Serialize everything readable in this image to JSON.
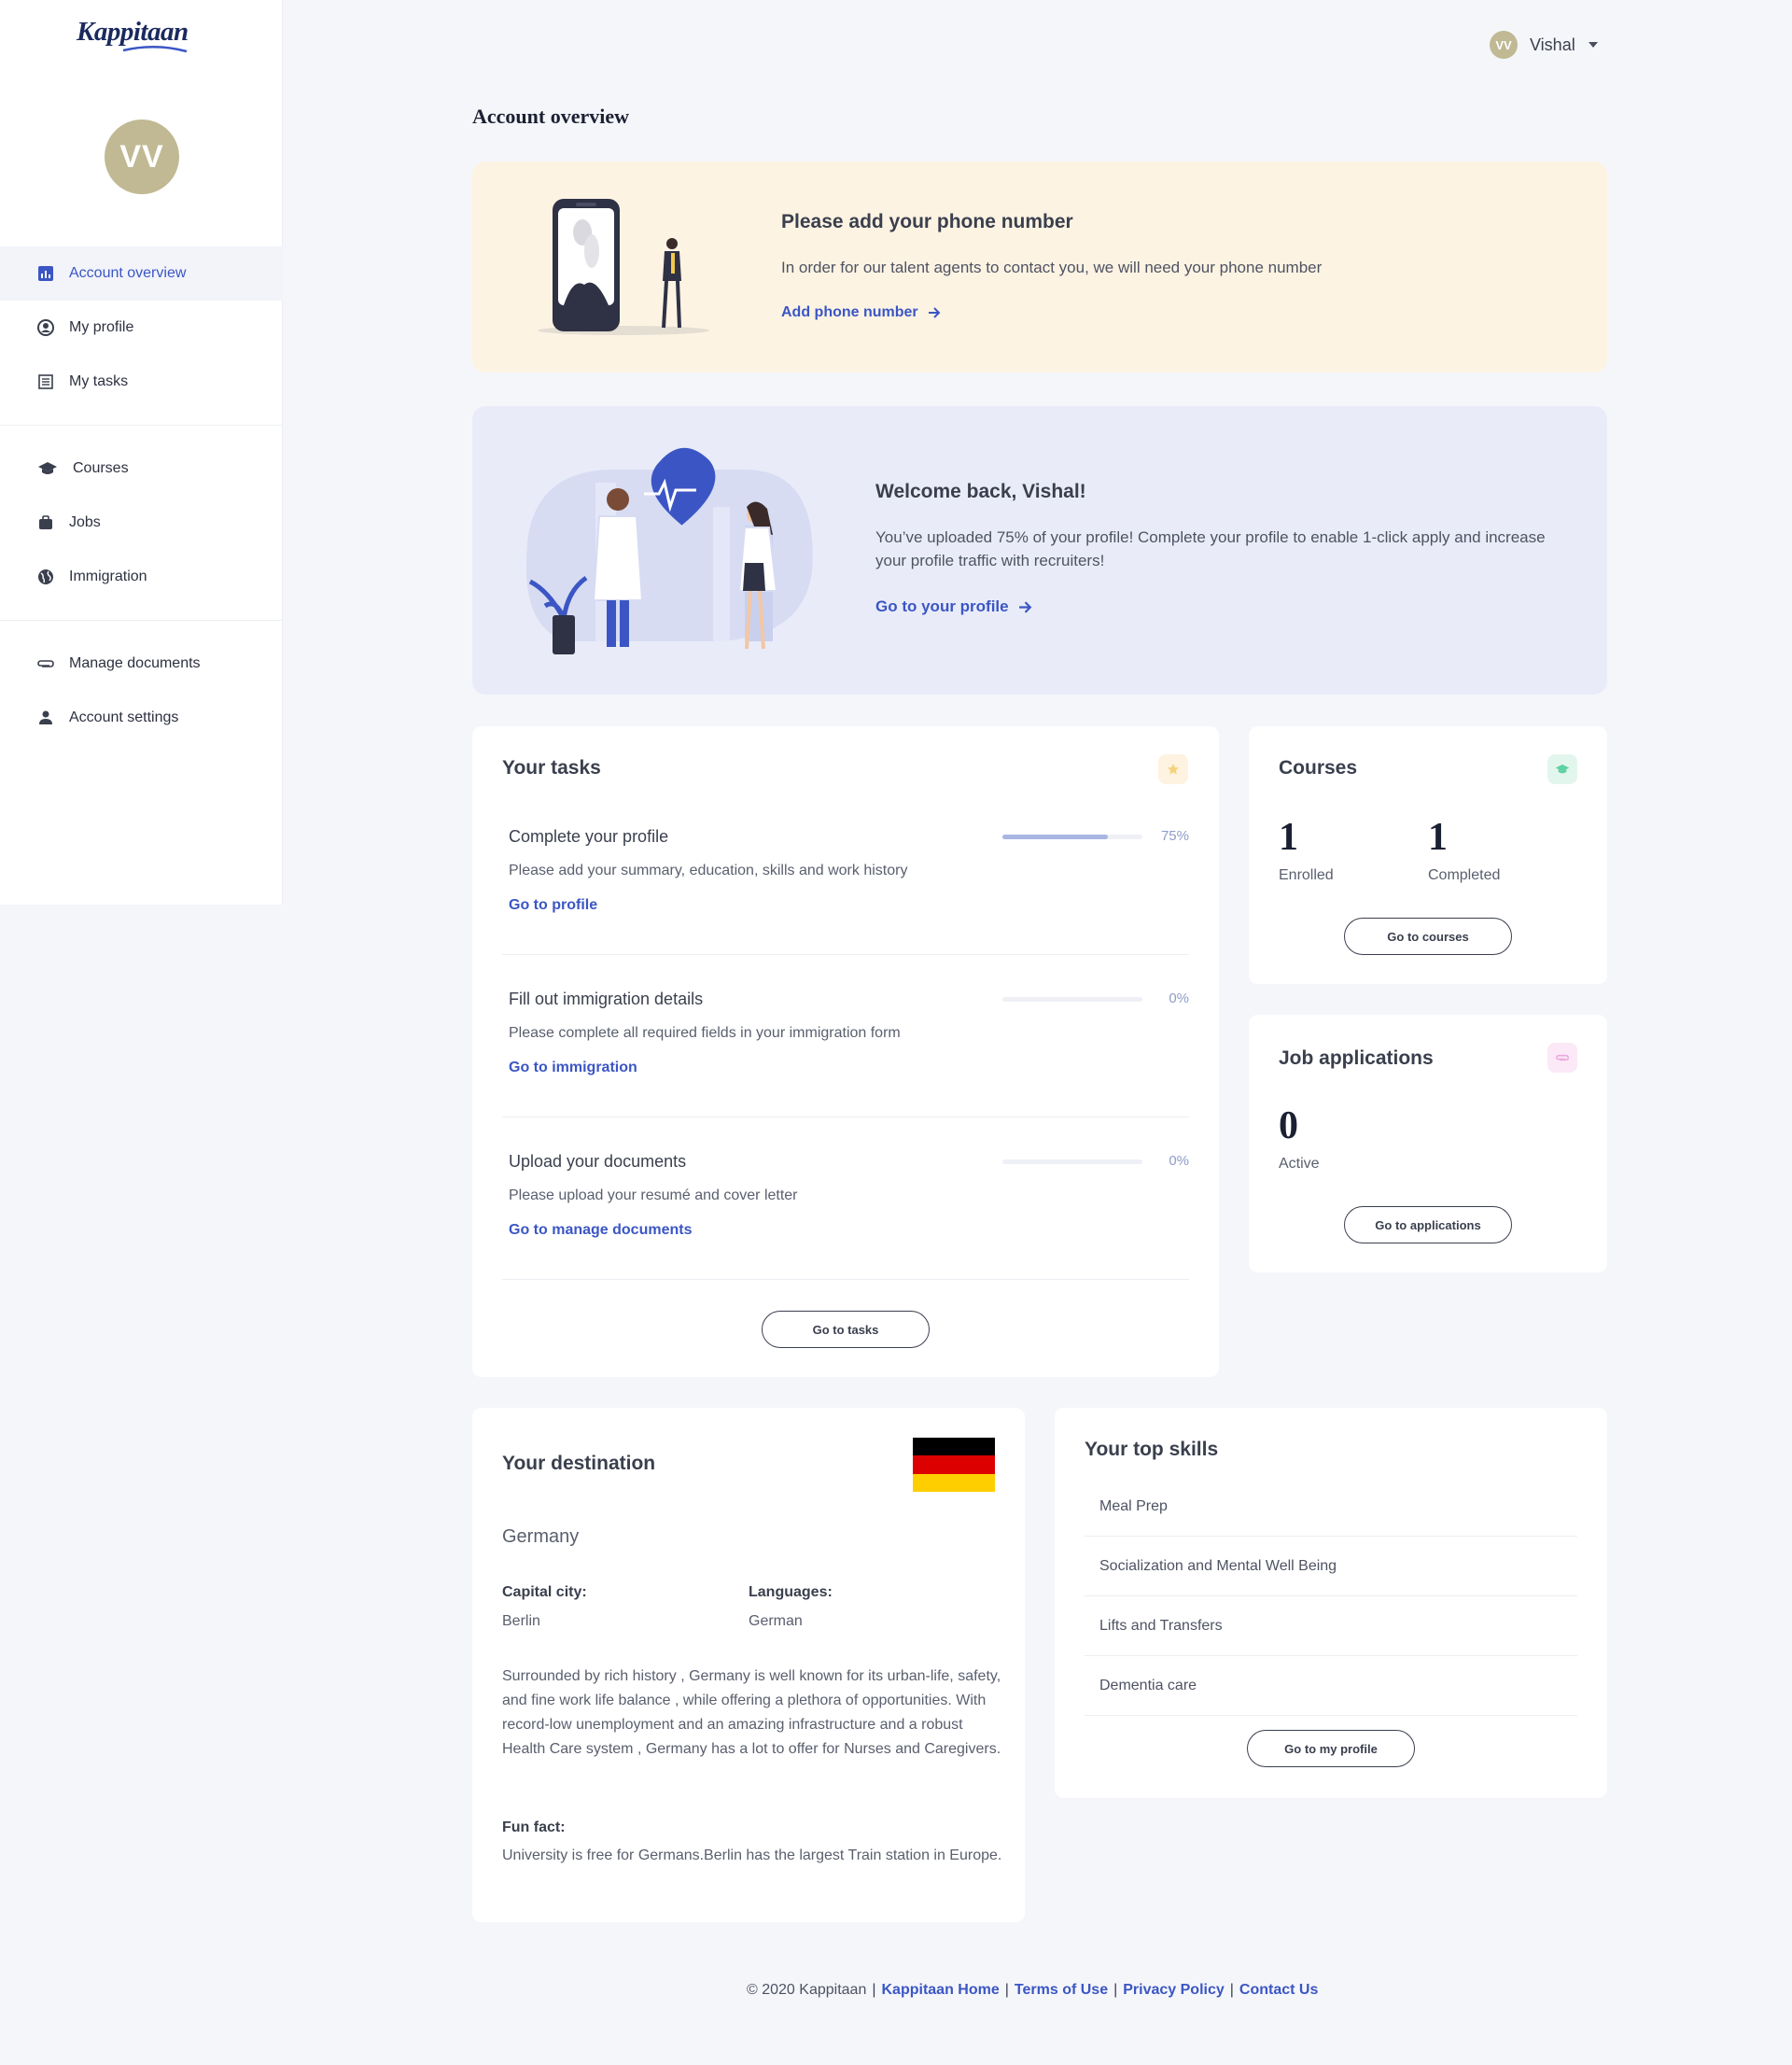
{
  "brand": {
    "name": "Kappitaan"
  },
  "user": {
    "initials": "VV",
    "name": "Vishal"
  },
  "sidebar": {
    "items": [
      {
        "label": "Account overview",
        "icon": "chart-icon"
      },
      {
        "label": "My profile",
        "icon": "user-circle-icon"
      },
      {
        "label": "My tasks",
        "icon": "list-icon"
      },
      {
        "label": "Courses",
        "icon": "graduation-cap-icon"
      },
      {
        "label": "Jobs",
        "icon": "briefcase-icon"
      },
      {
        "label": "Immigration",
        "icon": "globe-icon"
      },
      {
        "label": "Manage documents",
        "icon": "paperclip-icon"
      },
      {
        "label": "Account settings",
        "icon": "person-icon"
      }
    ]
  },
  "page": {
    "title": "Account overview"
  },
  "phone_banner": {
    "title": "Please add your phone number",
    "text": "In order for our talent agents to contact you, we will need your phone number",
    "link": "Add phone number"
  },
  "welcome_banner": {
    "title": "Welcome back, Vishal!",
    "text": "You’ve uploaded 75% of your profile! Complete your profile to enable 1-click apply and increase your profile traffic with recruiters!",
    "link": "Go to your profile"
  },
  "tasks": {
    "title": "Your tasks",
    "items": [
      {
        "title": "Complete your profile",
        "desc": "Please add your summary, education, skills and work history",
        "link": "Go to profile",
        "progress": 0.75,
        "pct": "75%"
      },
      {
        "title": "Fill out immigration details",
        "desc": "Please complete all required fields in your immigration form",
        "link": "Go to immigration",
        "progress": 0,
        "pct": "0%"
      },
      {
        "title": "Upload your documents",
        "desc": "Please upload your resumé and cover letter",
        "link": "Go to manage documents",
        "progress": 0,
        "pct": "0%"
      }
    ],
    "button": "Go to tasks"
  },
  "courses": {
    "title": "Courses",
    "enrolled": "1",
    "enrolled_label": "Enrolled",
    "completed": "1",
    "completed_label": "Completed",
    "button": "Go to courses"
  },
  "jobs": {
    "title": "Job applications",
    "active": "0",
    "active_label": "Active",
    "button": "Go to applications"
  },
  "destination": {
    "title": "Your destination",
    "country": "Germany",
    "capital_label": "Capital city:",
    "capital": "Berlin",
    "languages_label": "Languages:",
    "languages": "German",
    "description": "Surrounded by rich history , Germany is well known for its urban-life, safety, and fine work life balance , while offering a plethora of opportunities. With record-low unemployment and an amazing infrastructure and a robust Health Care system , Germany has a lot to offer for Nurses and Caregivers.",
    "fun_fact_label": "Fun fact:",
    "fun_fact": "University is free for Germans.Berlin has the largest Train station in Europe.",
    "flag_colors": [
      "#000000",
      "#dd0000",
      "#ffce00"
    ]
  },
  "skills": {
    "title": "Your top skills",
    "items": [
      "Meal Prep",
      "Socialization and Mental Well Being",
      "Lifts and Transfers",
      "Dementia care"
    ],
    "button": "Go to my profile"
  },
  "footer": {
    "copyright": "© 2020 Kappitaan",
    "links": [
      "Kappitaan Home",
      "Terms of Use",
      "Privacy Policy",
      "Contact Us"
    ]
  },
  "colors": {
    "accent": "#3b56c4",
    "avatar": "#c0b993",
    "phone_banner_bg": "#fdf3e3",
    "welcome_banner_bg": "#e9ecf8"
  }
}
